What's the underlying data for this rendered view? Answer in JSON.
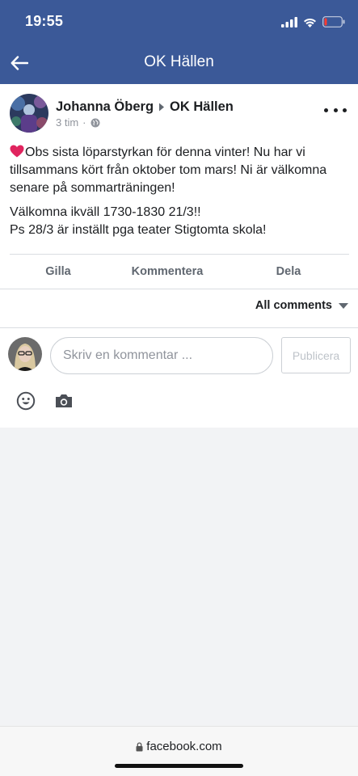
{
  "status_bar": {
    "time": "19:55"
  },
  "header": {
    "title": "OK Hällen"
  },
  "post": {
    "author": "Johanna Öberg",
    "group": "OK Hällen",
    "time": "3 tim",
    "separator": "·",
    "paragraph1": "Obs sista löparstyrkan för denna vinter! Nu har vi tillsammans kört från oktober tom mars! Ni är välkomna senare på sommarträningen!",
    "paragraph2": "Välkomna ikväll 1730-1830 21/3!!\nPs 28/3 är inställt pga teater Stigtomta skola!"
  },
  "actions": {
    "like": "Gilla",
    "comment": "Kommentera",
    "share": "Dela"
  },
  "comments": {
    "sort_label": "All comments"
  },
  "composer": {
    "placeholder": "Skriv en kommentar ...",
    "publish_label": "Publicera"
  },
  "browser": {
    "url": "facebook.com"
  },
  "colors": {
    "brand": "#3b5998",
    "heart": "#e0245e"
  }
}
